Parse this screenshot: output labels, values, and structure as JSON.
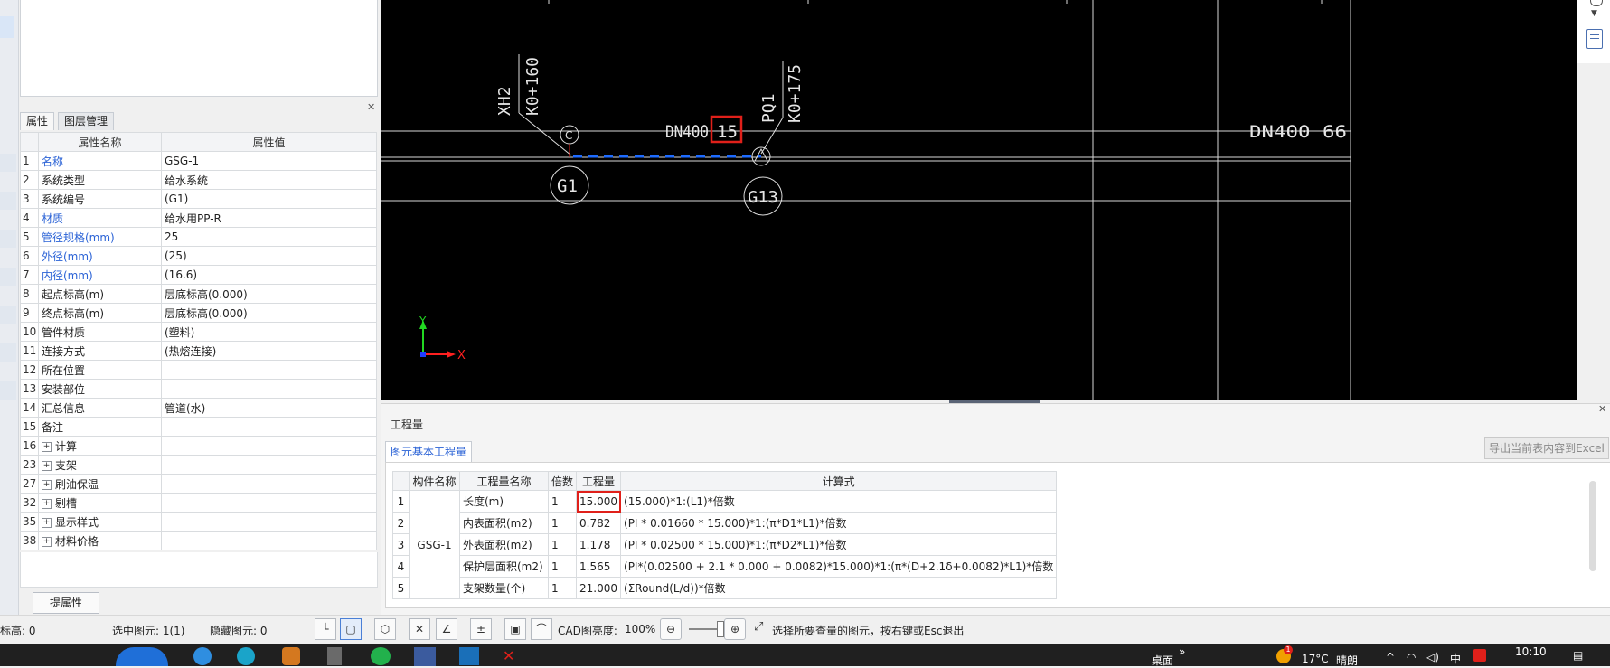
{
  "left_panel": {
    "tabs": [
      "属性",
      "图层管理"
    ],
    "table_headers": [
      "属性名称",
      "属性值"
    ],
    "rows": [
      {
        "num": "1",
        "name": "名称",
        "value": "GSG-1",
        "blue": true
      },
      {
        "num": "2",
        "name": "系统类型",
        "value": "给水系统",
        "blue": false
      },
      {
        "num": "3",
        "name": "系统编号",
        "value": "(G1)",
        "blue": false
      },
      {
        "num": "4",
        "name": "材质",
        "value": "给水用PP-R",
        "blue": true
      },
      {
        "num": "5",
        "name": "管径规格(mm)",
        "value": "25",
        "blue": true
      },
      {
        "num": "6",
        "name": "外径(mm)",
        "value": "(25)",
        "blue": true
      },
      {
        "num": "7",
        "name": "内径(mm)",
        "value": "(16.6)",
        "blue": true
      },
      {
        "num": "8",
        "name": "起点标高(m)",
        "value": "层底标高(0.000)",
        "blue": false
      },
      {
        "num": "9",
        "name": "终点标高(m)",
        "value": "层底标高(0.000)",
        "blue": false
      },
      {
        "num": "10",
        "name": "管件材质",
        "value": "(塑料)",
        "blue": false
      },
      {
        "num": "11",
        "name": "连接方式",
        "value": "(热熔连接)",
        "blue": false
      },
      {
        "num": "12",
        "name": "所在位置",
        "value": "",
        "blue": false
      },
      {
        "num": "13",
        "name": "安装部位",
        "value": "",
        "blue": false
      },
      {
        "num": "14",
        "name": "汇总信息",
        "value": "管道(水)",
        "blue": false
      },
      {
        "num": "15",
        "name": "备注",
        "value": "",
        "blue": false
      }
    ],
    "groups": [
      {
        "num": "16",
        "name": "计算"
      },
      {
        "num": "23",
        "name": "支架"
      },
      {
        "num": "27",
        "name": "刷油保温"
      },
      {
        "num": "32",
        "name": "剔槽"
      },
      {
        "num": "35",
        "name": "显示样式"
      },
      {
        "num": "38",
        "name": "材料价格"
      }
    ],
    "extract_button": "提属性"
  },
  "cad": {
    "labels": {
      "xh2": "XH2",
      "k0160": "K0+160",
      "pq1": "PQ1",
      "k0175": "K0+175",
      "dn400_left": "DN400",
      "len15": "15",
      "dn400_right": "DN400 66",
      "g1": "G1",
      "g13": "G13",
      "c_marker": "C",
      "axis_y": "Y",
      "axis_x": "X"
    },
    "colors": {
      "line": "#e6e6e6",
      "pipe": "#1e6bff",
      "highlight": "#e0201a",
      "axis_y": "#22d822",
      "axis_x": "#ff2020"
    }
  },
  "quantity": {
    "title": "工程量",
    "tab": "图元基本工程量",
    "export_button": "导出当前表内容到Excel",
    "headers": [
      "构件名称",
      "工程量名称",
      "倍数",
      "工程量",
      "计算式"
    ],
    "component": "GSG-1",
    "rows": [
      {
        "num": "1",
        "name": "长度(m)",
        "mult": "1",
        "qty": "15.000",
        "formula": "(15.000)*1:(L1)*倍数"
      },
      {
        "num": "2",
        "name": "内表面积(m2)",
        "mult": "1",
        "qty": "0.782",
        "formula": "(PI * 0.01660 * 15.000)*1:(π*D1*L1)*倍数"
      },
      {
        "num": "3",
        "name": "外表面积(m2)",
        "mult": "1",
        "qty": "1.178",
        "formula": "(PI * 0.02500 * 15.000)*1:(π*D2*L1)*倍数"
      },
      {
        "num": "4",
        "name": "保护层面积(m2)",
        "mult": "1",
        "qty": "1.565",
        "formula": "(PI*(0.02500 + 2.1 * 0.000 + 0.0082)*15.000)*1:(π*(D+2.1δ+0.0082)*L1)*倍数"
      },
      {
        "num": "5",
        "name": "支架数量(个)",
        "mult": "1",
        "qty": "21.000",
        "formula": "(ΣRound(L/d))*倍数"
      }
    ]
  },
  "status_bar": {
    "elev": "标高:  0",
    "selected": "选中图元:  1(1)",
    "hidden": "隐藏图元:  0",
    "cad_brightness_label": "CAD图亮度:",
    "cad_brightness_value": "100%",
    "hint": "选择所要查量的图元，按右键或Esc退出"
  },
  "taskbar": {
    "desktop": "桌面",
    "weather_temp": "17°C",
    "weather_text": "晴朗",
    "ime": "中",
    "time": "10:10",
    "notification_count": "1"
  }
}
